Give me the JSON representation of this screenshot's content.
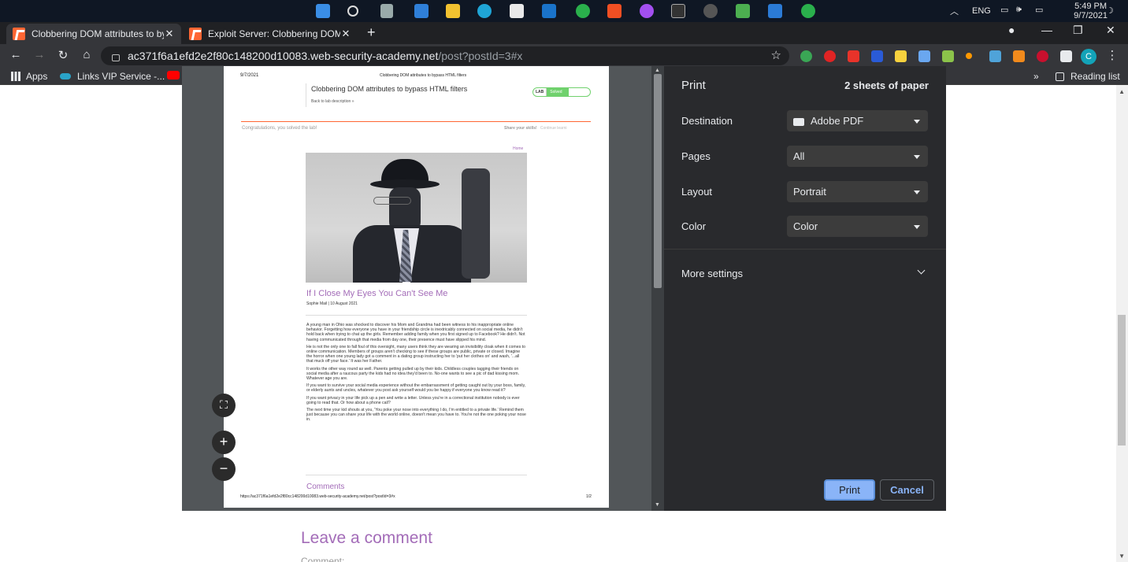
{
  "taskbar": {
    "language": "ENG",
    "time": "5:49 PM",
    "date": "9/7/2021"
  },
  "tabs": [
    {
      "label": "Clobbering DOM attributes to by",
      "close": "✕"
    },
    {
      "label": "Exploit Server: Clobbering DOM a",
      "close": "✕"
    }
  ],
  "toolbar": {
    "url_host": "ac371f6a1efd2e2f80c148200d10083.web-security-academy.net",
    "url_path": "/post?postId=3#x"
  },
  "bookmarks": {
    "apps": "Apps",
    "links": "Links VIP Service -...",
    "reading_list": "Reading list"
  },
  "page": {
    "leave_comment": "Leave a comment",
    "comment_stub": "Comment:"
  },
  "preview": {
    "date": "9/7/2021",
    "header_title": "Clobbering DOM attributes to bypass HTML filters",
    "lab_title": "Clobbering DOM attributes to bypass HTML filters",
    "back_link": "Back to lab description »",
    "lab_badge": "LAB",
    "lab_status": "Solved",
    "congrats": "Congratulations, you solved the lab!",
    "share": "Share your skills!",
    "continue": "Continue learni",
    "home": "Home",
    "post_title": "If I Close My Eyes You Can't See Me",
    "author": "Sophie Mail | 10 August 2021",
    "paragraphs": [
      "A young man in Ohio was shocked to discover his Mom and Grandma had been witness to his inappropriate online behavior. Forgetting how everyone you have in your friendship circle is inextricably connected on social media, he didn't hold back when trying to chat up the girls. Remember adding family when you first signed up to Facebook? He didn't. Not having communicated through that media from day one, their presence must have slipped his mind.",
      "He is not the only one to fall foul of this oversight, many users think they are wearing an invisibility cloak when it comes to online communication. Members of groups aren't checking to see if these groups are public, private or closed. Imagine the horror when one young lady got a comment in a dating group instructing her to 'put her clothes on' and wash, '...all that muck off your face.' It was her Father.",
      "It works the other way round as well. Parents getting pulled up by their kids. Childless couples tagging their friends on social media after a raucous party the kids had no idea they'd been to. No-one wants to see a pic of dad kissing mom. Whatever age you are.",
      "If you want to survive your social media experience without the embarrassment of getting caught out by your boss, family, or elderly aunts and uncles, whatever you post ask yourself would you be happy if everyone you know read it?",
      "If you want privacy in your life pick up a pen and write a letter. Unless you're in a correctional institution nobody is ever going to read that. Or how about a phone call?",
      "The next time your kid shouts at you, 'You poke your nose into everything I do, I'm entitled to a private life.' Remind them just because you can share your life with the world online, doesn't mean you have to. You're not the one poking your nose in."
    ],
    "comments": "Comments",
    "footer_url": "https://ac371f6a1efd2e2f80cc148200d10083.web-security-academy.net/post?postId=3#x",
    "page_num": "1/2"
  },
  "print": {
    "title": "Print",
    "sheets": "2 sheets of paper",
    "destination_label": "Destination",
    "destination_value": "Adobe PDF",
    "pages_label": "Pages",
    "pages_value": "All",
    "layout_label": "Layout",
    "layout_value": "Portrait",
    "color_label": "Color",
    "color_value": "Color",
    "more_settings": "More settings",
    "print_button": "Print",
    "cancel_button": "Cancel"
  },
  "zoom": {
    "fit": "⛶",
    "in": "+",
    "out": "−"
  },
  "colors": {
    "accent": "#8ab4f8",
    "brand": "#ff6633",
    "link_purple": "#a36cb8",
    "solved_green": "#70d16d"
  }
}
